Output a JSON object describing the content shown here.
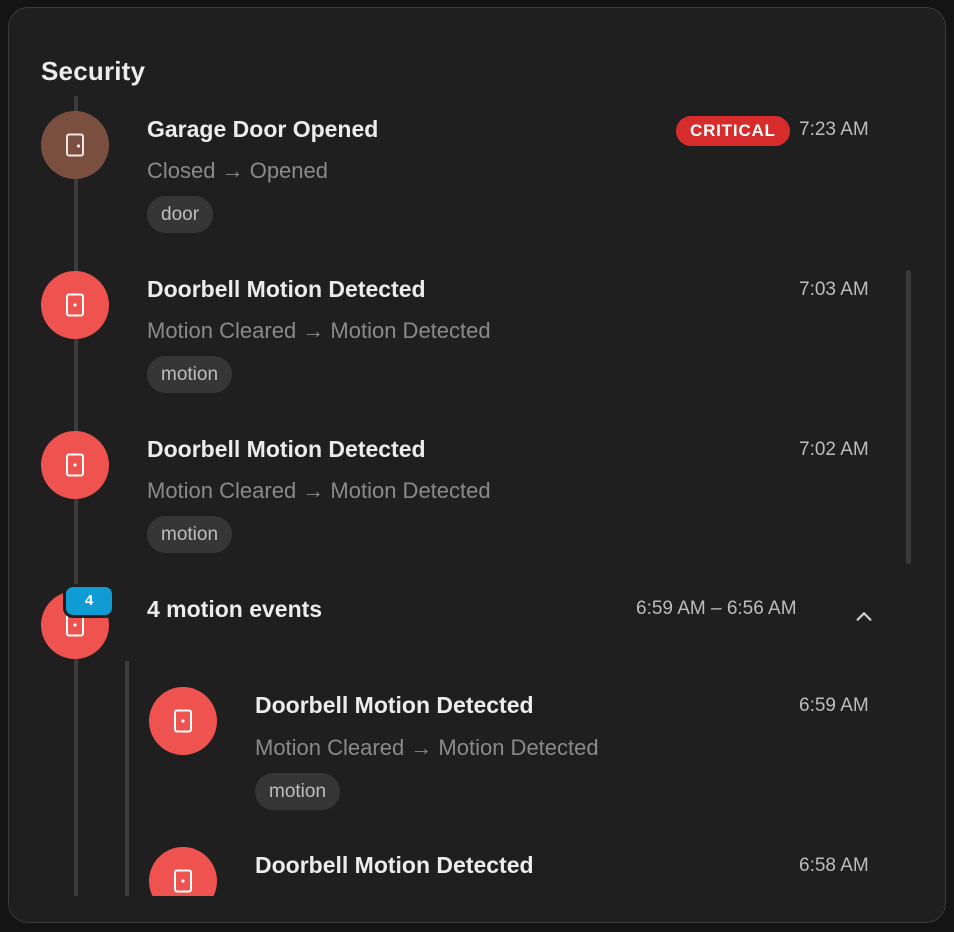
{
  "card": {
    "title": "Security"
  },
  "colors": {
    "garage_avatar": "#7a4f40",
    "motion_avatar": "#ef5350",
    "critical_badge": "#d62c2c",
    "count_badge": "#0f9bd3"
  },
  "events": [
    {
      "icon": "door-icon",
      "title": "Garage Door Opened",
      "subtitle": "Closed → Opened",
      "tag": "door",
      "badge": "CRITICAL",
      "time": "7:23 AM"
    },
    {
      "icon": "door-icon",
      "title": "Doorbell Motion Detected",
      "subtitle": "Motion Cleared → Motion Detected",
      "tag": "motion",
      "time": "7:03 AM"
    },
    {
      "icon": "door-icon",
      "title": "Doorbell Motion Detected",
      "subtitle": "Motion Cleared → Motion Detected",
      "tag": "motion",
      "time": "7:02 AM"
    }
  ],
  "group": {
    "count_badge": "4",
    "title": "4 motion events",
    "time_range": "6:59 AM – 6:56 AM",
    "expanded_icon": "chevron-up-icon",
    "items": [
      {
        "icon": "door-icon",
        "title": "Doorbell Motion Detected",
        "subtitle": "Motion Cleared → Motion Detected",
        "tag": "motion",
        "time": "6:59 AM"
      },
      {
        "icon": "door-icon",
        "title": "Doorbell Motion Detected",
        "time": "6:58 AM"
      }
    ]
  }
}
